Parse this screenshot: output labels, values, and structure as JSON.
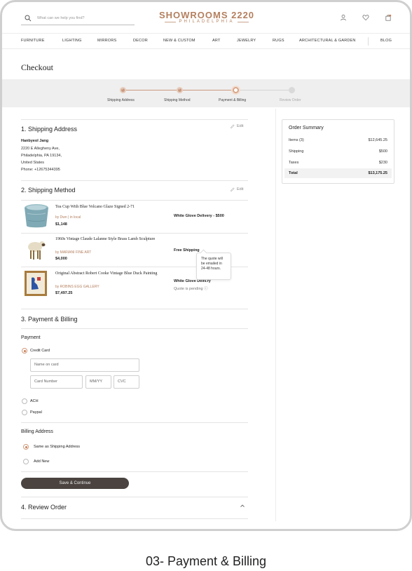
{
  "header": {
    "search_placeholder": "What can we help you find?",
    "brand": "SHOWROOMS 2220",
    "city": "PHILADELPHIA"
  },
  "nav": [
    "FURNITURE",
    "LIGHTING",
    "MIRRORS",
    "DECOR",
    "NEW & CUSTOM",
    "ART",
    "JEWELRY",
    "RUGS",
    "ARCHITECTURAL & GARDEN",
    "BLOG"
  ],
  "page_title": "Checkout",
  "steps": [
    "Shipping Address",
    "Shipping Method",
    "Payment & Billing",
    "Review Order"
  ],
  "shipping_address": {
    "title": "1. Shipping Address",
    "edit": "Edit",
    "name": "Hanbyeol Jang",
    "lines": [
      "2220 E Allegheny Ave,",
      "Philadelphia, PA 19134,",
      "United States",
      "Phone: +12675344395"
    ]
  },
  "shipping_method": {
    "title": "2. Shipping Method",
    "edit": "Edit",
    "items": [
      {
        "title": "Tea Cup With Blue Volcano Glaze Signed 2-71",
        "by": "by Dwn  |  in local",
        "price": "$1,148",
        "shipping": "White Glove Delivery - $500"
      },
      {
        "title": "1960s Vintage Claude Lalanne Style Brass Lamb Sculpture",
        "by": "by MARIANI FINE ART",
        "price": "$4,000",
        "shipping": "Free Shipping"
      },
      {
        "title": "Original Abstract Robert Cooke Vintage Blue Duck Painting",
        "by": "by ROBINS EGG GALLERY",
        "price": "$7,497.25",
        "shipping": "White Glove Deliv.ry"
      }
    ],
    "quote_pending": "Quote is pending ⓘ",
    "tooltip": "The quote will be emailed in 24-48 hours."
  },
  "payment": {
    "title": "3. Payment & Billing",
    "payment_label": "Payment",
    "credit_card": "Credit Card",
    "name_on_card": "Name on card",
    "card_number": "Card Number",
    "mmyy": "MM/YY",
    "cvc": "CVC",
    "ach": "ACH",
    "paypal": "Paypal",
    "billing_label": "Billing Address",
    "same_as_shipping": "Same as Shipping Address",
    "add_new": "Add New",
    "save_button": "Save & Continue"
  },
  "review": {
    "title": "4. Review Order"
  },
  "summary": {
    "title": "Order Summary",
    "rows": [
      {
        "label": "Items (3)",
        "value": "$12,645.25"
      },
      {
        "label": "Shipping",
        "value": "$500"
      },
      {
        "label": "Taxes",
        "value": "$230"
      }
    ],
    "total_label": "Total",
    "total_value": "$13,175.25"
  },
  "caption": "03- Payment & Billing",
  "colors": {
    "accent": "#b47f5e",
    "button": "#4a4340"
  }
}
